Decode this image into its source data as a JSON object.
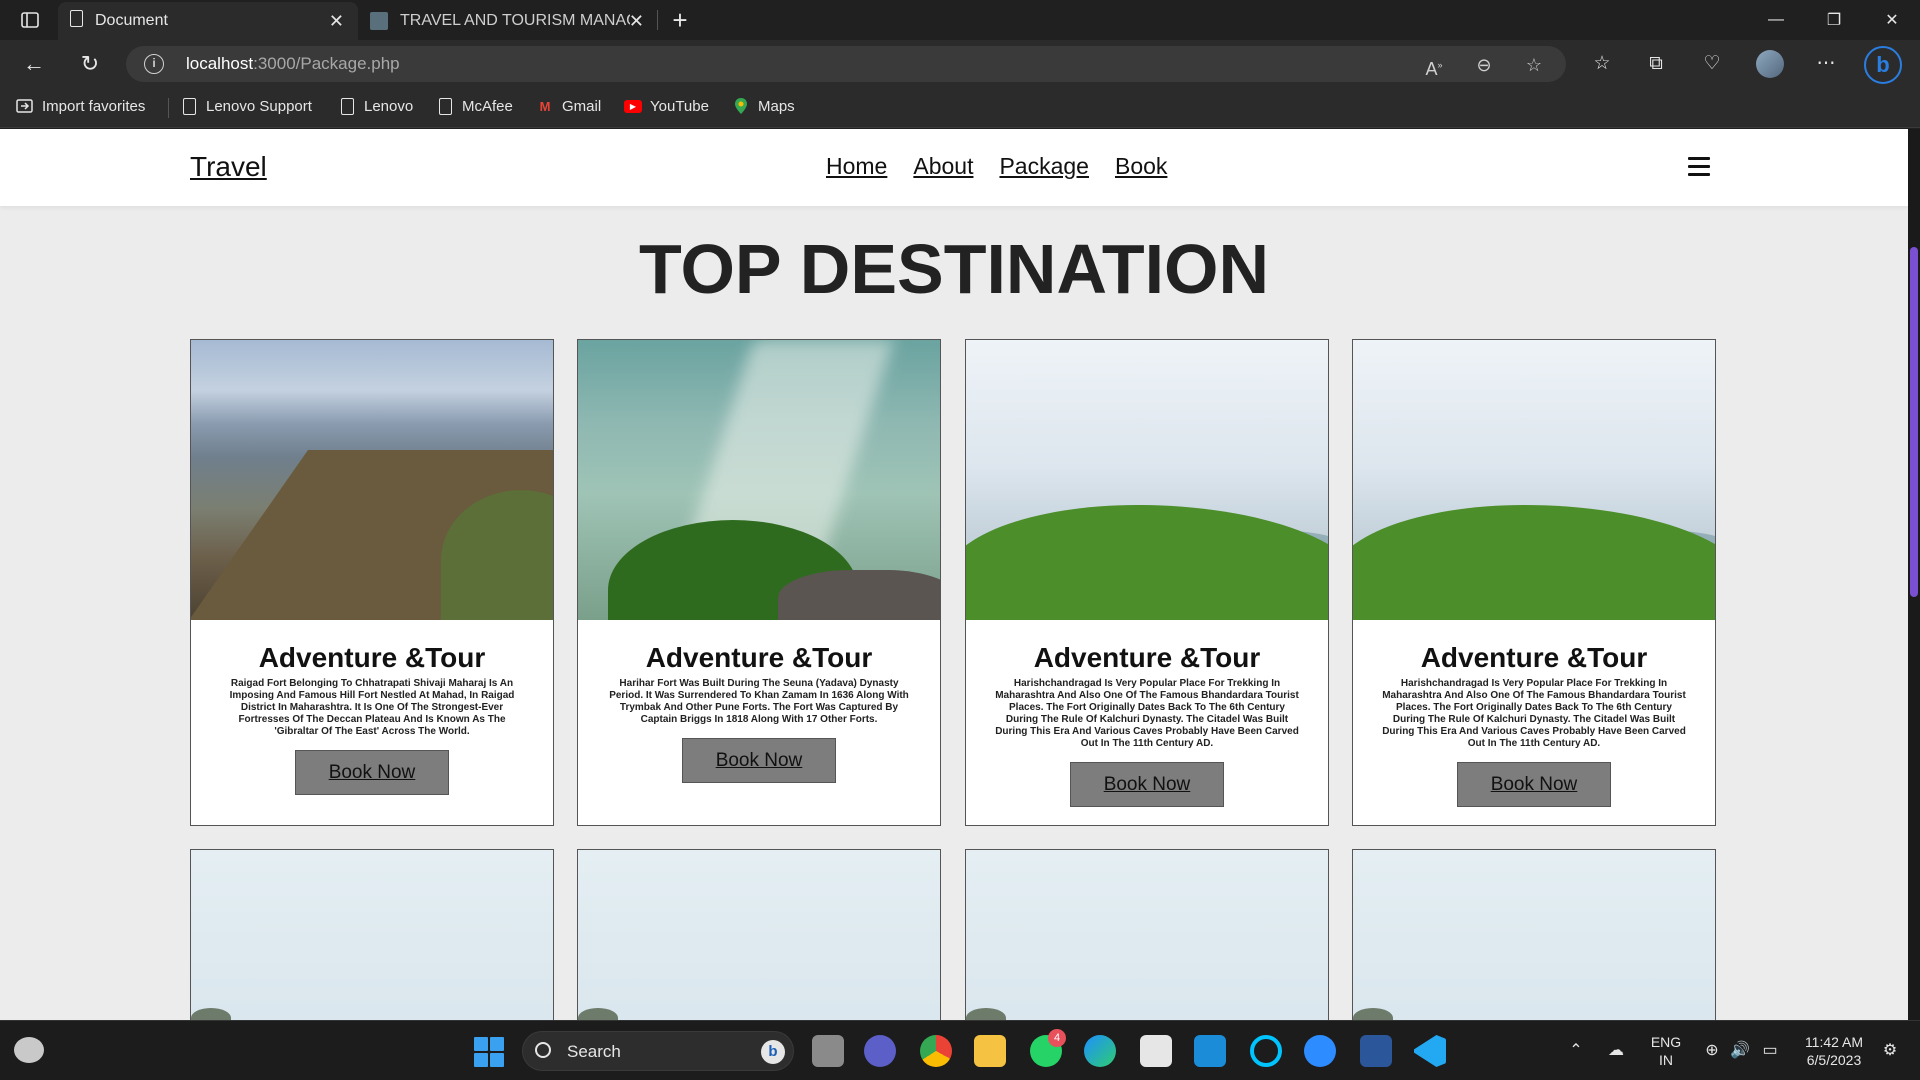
{
  "browser": {
    "tabs": [
      {
        "title": "Document",
        "active": true
      },
      {
        "title": "TRAVEL AND TOURISM MANAGE",
        "active": false
      }
    ],
    "url_host": "localhost",
    "url_path": ":3000/Package.php",
    "window_controls": {
      "minimize": "—",
      "restore": "❐",
      "close": "✕"
    },
    "favorites": [
      {
        "label": "Import favorites",
        "icon": "import-icon"
      },
      {
        "label": "Lenovo Support",
        "icon": "page-icon"
      },
      {
        "label": "Lenovo",
        "icon": "page-icon"
      },
      {
        "label": "McAfee",
        "icon": "page-icon"
      },
      {
        "label": "Gmail",
        "icon": "gmail-icon"
      },
      {
        "label": "YouTube",
        "icon": "youtube-icon"
      },
      {
        "label": "Maps",
        "icon": "maps-icon"
      }
    ]
  },
  "site": {
    "logo": "Travel",
    "nav": [
      "Home",
      "About",
      "Package",
      "Book"
    ],
    "heading": "TOP DESTINATION",
    "cards": [
      {
        "title": "Adventure &Tour",
        "desc": "Raigad Fort Belonging To Chhatrapati Shivaji Maharaj Is An Imposing And Famous Hill Fort Nestled At Mahad, In Raigad District In Maharashtra. It Is One Of The Strongest-Ever Fortresses Of The Deccan Plateau And Is Known As The 'Gibraltar Of The East' Across The World.",
        "button": "Book Now"
      },
      {
        "title": "Adventure &Tour",
        "desc": "Harihar Fort Was Built During The Seuna (Yadava) Dynasty Period. It Was Surrendered To Khan Zamam In 1636 Along With Trymbak And Other Pune Forts. The Fort Was Captured By Captain Briggs In 1818 Along With 17 Other Forts.",
        "button": "Book Now"
      },
      {
        "title": "Adventure &Tour",
        "desc": "Harishchandragad Is Very Popular Place For Trekking In Maharashtra And Also One Of The Famous Bhandardara Tourist Places. The Fort Originally Dates Back To The 6th Century During The Rule Of Kalchuri Dynasty. The Citadel Was Built During This Era And Various Caves Probably Have Been Carved Out In The 11th Century AD.",
        "button": "Book Now"
      },
      {
        "title": "Adventure &Tour",
        "desc": "Harishchandragad Is Very Popular Place For Trekking In Maharashtra And Also One Of The Famous Bhandardara Tourist Places. The Fort Originally Dates Back To The 6th Century During The Rule Of Kalchuri Dynasty. The Citadel Was Built During This Era And Various Caves Probably Have Been Carved Out In The 11th Century AD.",
        "button": "Book Now"
      }
    ]
  },
  "taskbar": {
    "search_label": "Search",
    "whatsapp_badge": "4",
    "language_line1": "ENG",
    "language_line2": "IN",
    "time": "11:42 AM",
    "date": "6/5/2023"
  },
  "colors": {
    "accent_scroll": "#7a4fd1",
    "button_bg": "#7d7d7d",
    "page_bg": "#ececec"
  }
}
